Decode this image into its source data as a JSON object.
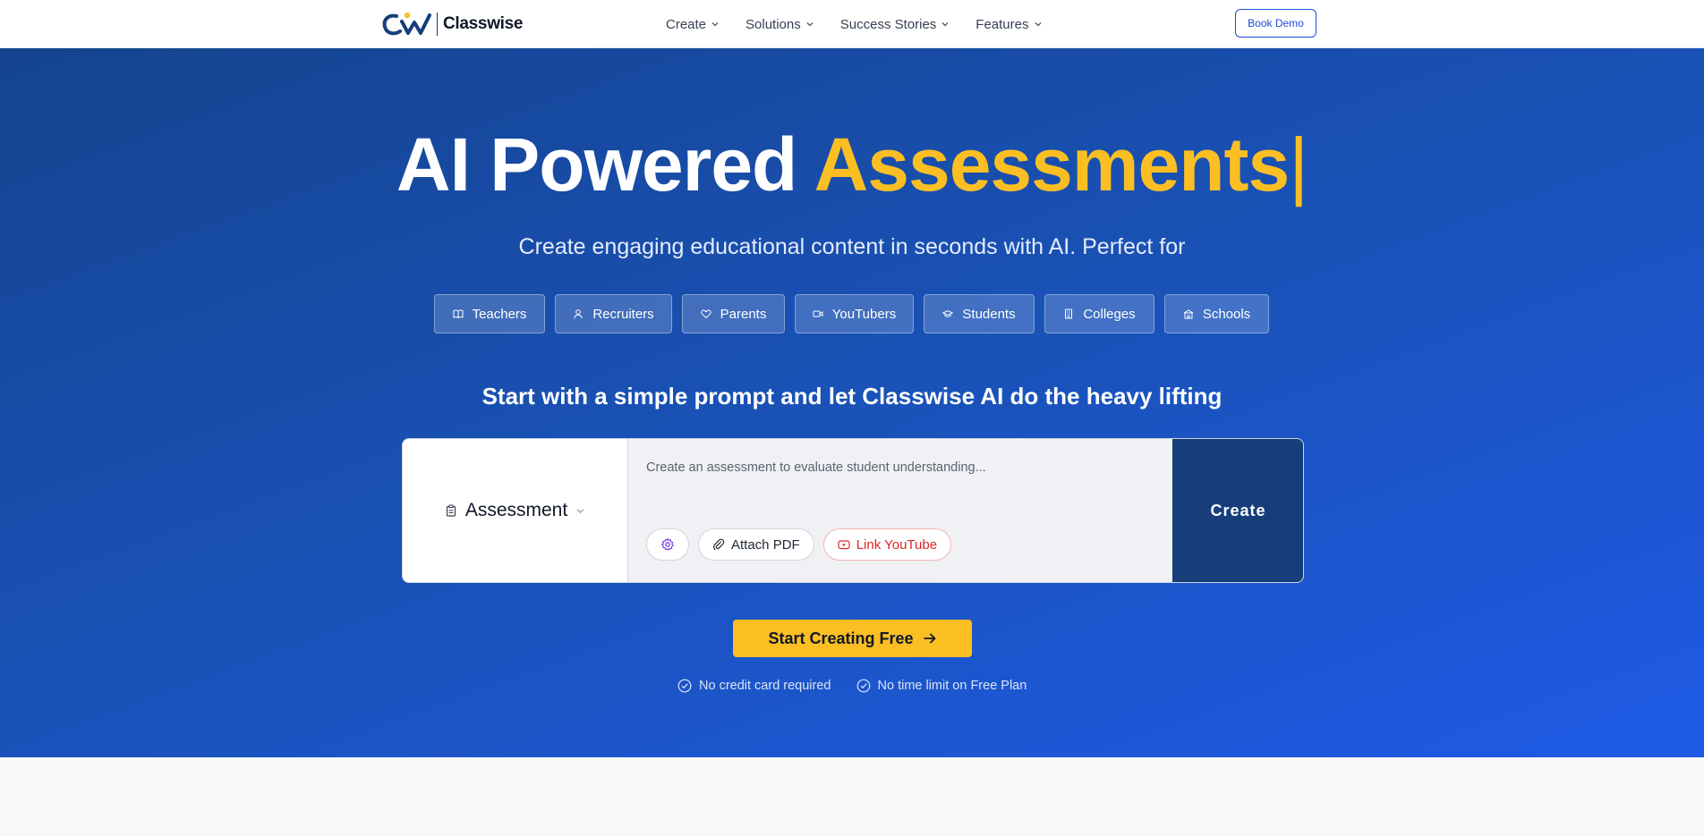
{
  "brand": {
    "name": "Classwise",
    "logo_icon": "classwise-logo-icon"
  },
  "nav": {
    "items": [
      {
        "label": "Create"
      },
      {
        "label": "Solutions"
      },
      {
        "label": "Success Stories"
      },
      {
        "label": "Features"
      }
    ],
    "book_demo": "Book Demo"
  },
  "hero": {
    "title_main": "AI Powered",
    "title_accent": "Assessments",
    "title_cursor": "|",
    "subtitle": "Create engaging educational content in seconds with AI. Perfect for",
    "audiences": [
      {
        "label": "Teachers",
        "icon": "book-icon"
      },
      {
        "label": "Recruiters",
        "icon": "user-icon"
      },
      {
        "label": "Parents",
        "icon": "heart-icon"
      },
      {
        "label": "YouTubers",
        "icon": "video-icon"
      },
      {
        "label": "Students",
        "icon": "graduation-cap-icon"
      },
      {
        "label": "Colleges",
        "icon": "building-icon"
      },
      {
        "label": "Schools",
        "icon": "school-icon"
      }
    ],
    "prompt_heading": "Start with a simple prompt and let Classwise AI do the heavy lifting"
  },
  "composer": {
    "content_type": "Assessment",
    "placeholder": "Create an assessment to evaluate student understanding...",
    "tools": {
      "attach_pdf": "Attach PDF",
      "link_youtube": "Link YouTube"
    },
    "create_label": "Create"
  },
  "cta": {
    "label": "Start Creating Free",
    "notes": [
      "No credit card required",
      "No time limit on Free Plan"
    ]
  },
  "colors": {
    "accent_yellow": "#fbbf24",
    "primary_blue": "#1d4ed8",
    "create_button": "#173e7b",
    "youtube_red": "#dc2626"
  }
}
